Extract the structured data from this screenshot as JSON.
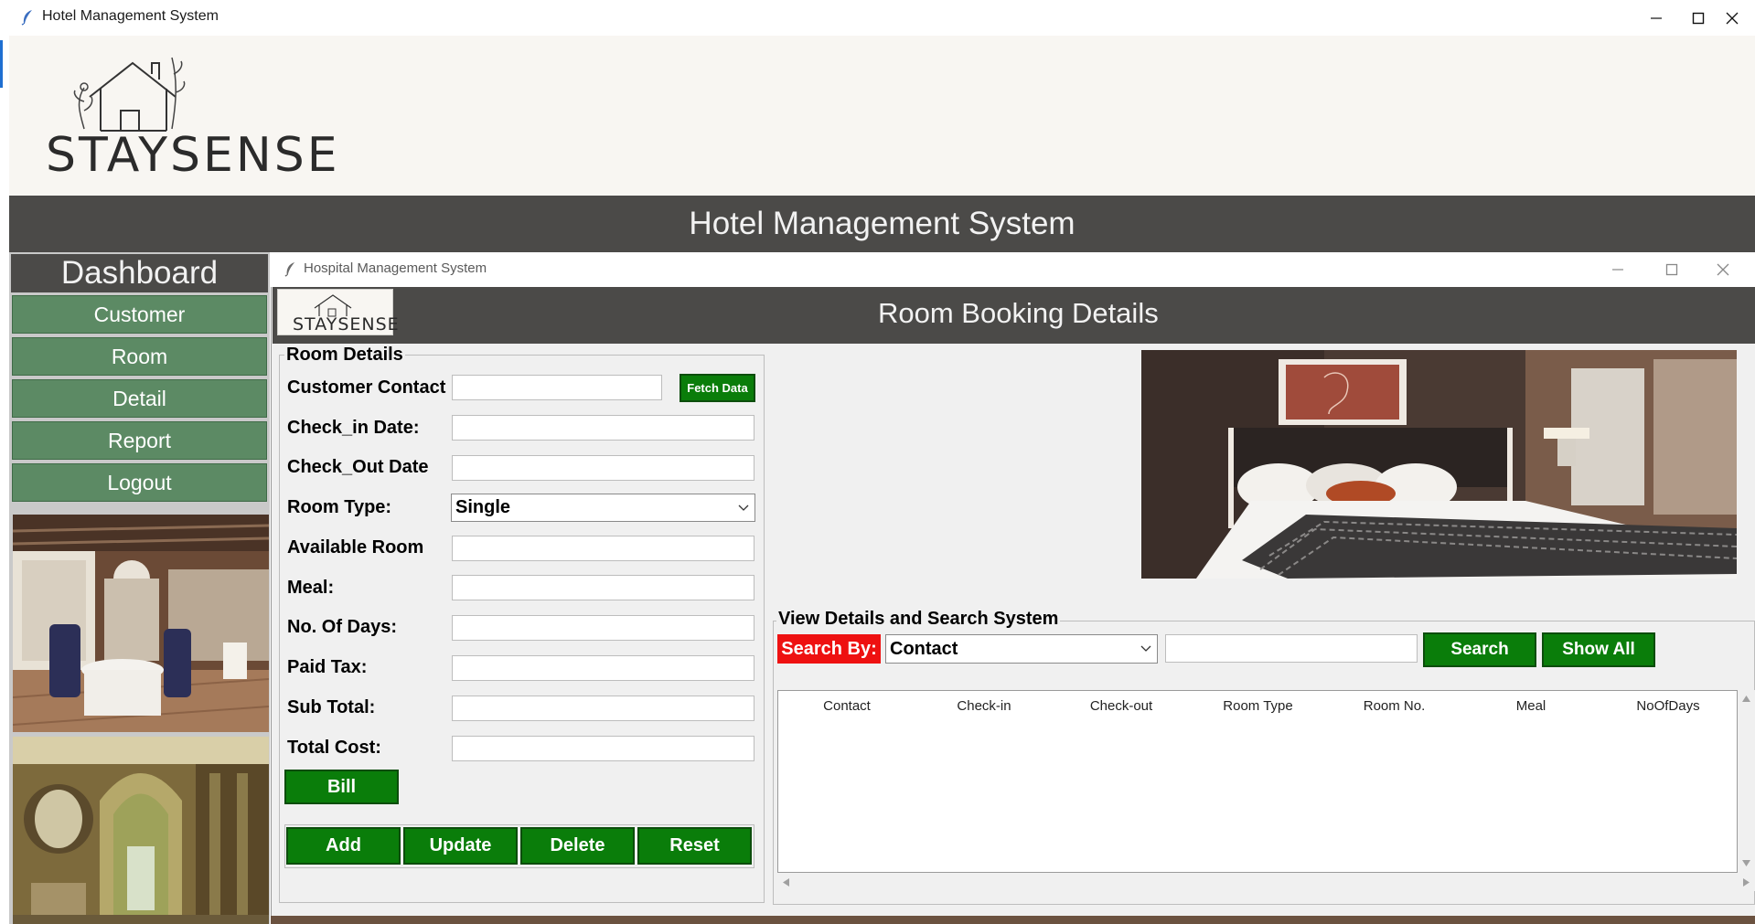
{
  "main_window": {
    "title": "Hotel Management System",
    "banner_title": "Hotel Management System",
    "logo_text": "STAYSENSE"
  },
  "sidebar": {
    "title": "Dashboard",
    "items": [
      {
        "label": "Customer"
      },
      {
        "label": "Room"
      },
      {
        "label": "Detail"
      },
      {
        "label": "Report"
      },
      {
        "label": "Logout"
      }
    ]
  },
  "child_window": {
    "title": "Hospital Management System",
    "header_title": "Room Booking Details",
    "logo_text": "STAYSENSE"
  },
  "room_details": {
    "group_label": "Room Details",
    "customer_contact_label": "Customer Contact",
    "customer_contact_value": "",
    "fetch_button": "Fetch Data",
    "check_in_label": "Check_in Date:",
    "check_in_value": "",
    "check_out_label": "Check_Out Date",
    "check_out_value": "",
    "room_type_label": "Room Type:",
    "room_type_value": "Single",
    "available_room_label": "Available Room",
    "available_room_value": "",
    "meal_label": "Meal:",
    "meal_value": "",
    "days_label": "No. Of Days:",
    "days_value": "",
    "paid_tax_label": "Paid Tax:",
    "paid_tax_value": "",
    "sub_total_label": "Sub Total:",
    "sub_total_value": "",
    "total_cost_label": "Total Cost:",
    "total_cost_value": "",
    "bill_button": "Bill",
    "add_button": "Add",
    "update_button": "Update",
    "delete_button": "Delete",
    "reset_button": "Reset"
  },
  "search_system": {
    "group_label": "View Details and Search System",
    "search_by_label": "Search By:",
    "search_by_value": "Contact",
    "search_text_value": "",
    "search_button": "Search",
    "show_all_button": "Show All"
  },
  "table": {
    "columns": [
      "Contact",
      "Check-in",
      "Check-out",
      "Room Type",
      "Room No.",
      "Meal",
      "NoOfDays"
    ],
    "rows": []
  },
  "colors": {
    "dark_header": "#4b4a48",
    "sidebar_button": "#5c8a64",
    "action_green": "#0a7d0a",
    "search_by_red": "#ee1111"
  }
}
